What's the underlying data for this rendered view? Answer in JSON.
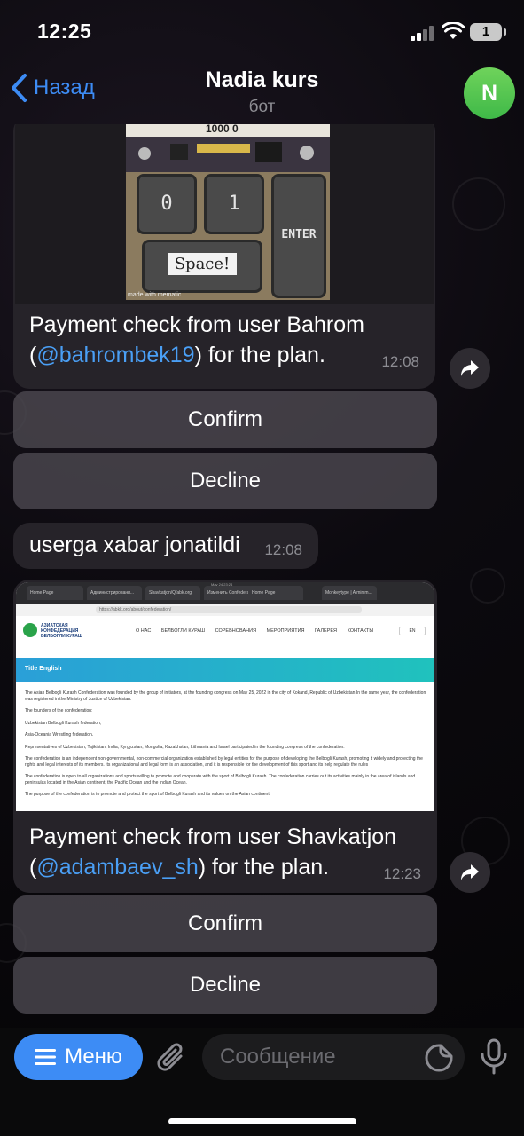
{
  "status_bar": {
    "time": "12:25",
    "battery": "1"
  },
  "header": {
    "back_label": "Назад",
    "title": "Nadia kurs",
    "subtitle": "бот",
    "avatar_letter": "N"
  },
  "messages": [
    {
      "type": "photo",
      "image": {
        "header_text": "1000 0",
        "key_zero": "0",
        "key_one": "1",
        "key_enter": "ENTER",
        "key_space": "Space!",
        "watermark": "made with mematic"
      },
      "caption_prefix": "Payment check from user Bahrom (",
      "mention": "@bahrombek19",
      "caption_suffix": ") for the plan.",
      "time": "12:08",
      "buttons": [
        "Confirm",
        "Decline"
      ]
    },
    {
      "type": "text",
      "text": "userga xabar jonatildi",
      "time": "12:08"
    },
    {
      "type": "photo",
      "image": {
        "tabs": [
          "Home Page",
          "Администрировани...",
          "Shavkatjon/Q/abk.org",
          "Изменить Confederat...",
          "Home Page",
          "Monkeytype | A minim..."
        ],
        "url": "https://abkk.org/about/confederation/",
        "logo_text": "АЗИАТСКАЯ КОНФЕДЕРАЦИЯ БЕЛБОГЛИ КУРАШ",
        "menu": [
          "О НАС",
          "БЕЛБОГЛИ КУРАШ",
          "СОРЕВНОВАНИЯ",
          "МЕРОПРИЯТИЯ",
          "ГАЛЕРЕЯ",
          "КОНТАКТЫ"
        ],
        "lang": "EN",
        "banner_title": "Title English",
        "paragraphs": [
          "The Asian Belbogli Kurash Confederation was founded by the group of initiators, at the founding congress on May 25, 2022 in the city of Kokand, Republic of Uzbekistan.In the same year, the confederation was registered in the Ministry of Justice of Uzbekistan.",
          "The founders of the confederation:",
          "Uzbekistan Belbogli Kurash federation;",
          "Asia-Oceania Wrestling federation.",
          "Representatives of Uzbekistan, Tajikistan, India, Kyrgyzstan, Mongolia, Kazakhstan, Lithuania and Israel participated in the founding congress of the confederation.",
          "The confederation is an independent non-governmental, non-commercial organization established by legal entities for the purpose of developing the Belbogli Kurash, promoting it widely and protecting the rights and legal interests of its members. Its organizational and legal form is an association, and it is responsible for the development of this sport and its help regulate the rules",
          "The confederation is open to all organizations and sports willing to promote and cooperate with the sport of Belbogli Kurash. The confederation carries out its activities mainly in the area of islands and peninsulas located in the Asian continent, the Pacific Ocean and the Indian Ocean.",
          "The purpose of the confederation is to promote and protect the sport of Belbogli Kurash and its values on the Asian continent."
        ]
      },
      "caption_prefix": "Payment check from user Shavkatjon (",
      "mention": "@adambaev_sh",
      "caption_suffix": ") for the plan.",
      "time": "12:23",
      "buttons": [
        "Confirm",
        "Decline"
      ]
    }
  ],
  "input_bar": {
    "menu_label": "Меню",
    "placeholder": "Сообщение"
  },
  "colors": {
    "accent": "#3d8cf5",
    "bubble": "#262329",
    "avatar": "#4cc04e",
    "mention": "#4a9ff5"
  }
}
